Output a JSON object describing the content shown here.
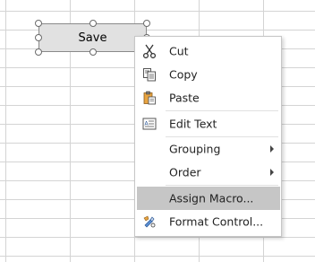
{
  "form_control": {
    "label": "Save"
  },
  "context_menu": {
    "items": [
      {
        "label": "Cut",
        "icon": "scissors-icon"
      },
      {
        "label": "Copy",
        "icon": "copy-icon"
      },
      {
        "label": "Paste",
        "icon": "paste-icon"
      },
      {
        "label": "Edit Text",
        "icon": "edit-text-icon"
      },
      {
        "label": "Grouping",
        "icon": "",
        "submenu": true
      },
      {
        "label": "Order",
        "icon": "",
        "submenu": true
      },
      {
        "label": "Assign Macro...",
        "icon": "",
        "highlighted": true
      },
      {
        "label": "Format Control...",
        "icon": "format-control-icon"
      }
    ]
  },
  "colors": {
    "highlight": "#c6c6c6",
    "gridline": "#d4d4d4",
    "button_face": "#e1e1e1"
  }
}
